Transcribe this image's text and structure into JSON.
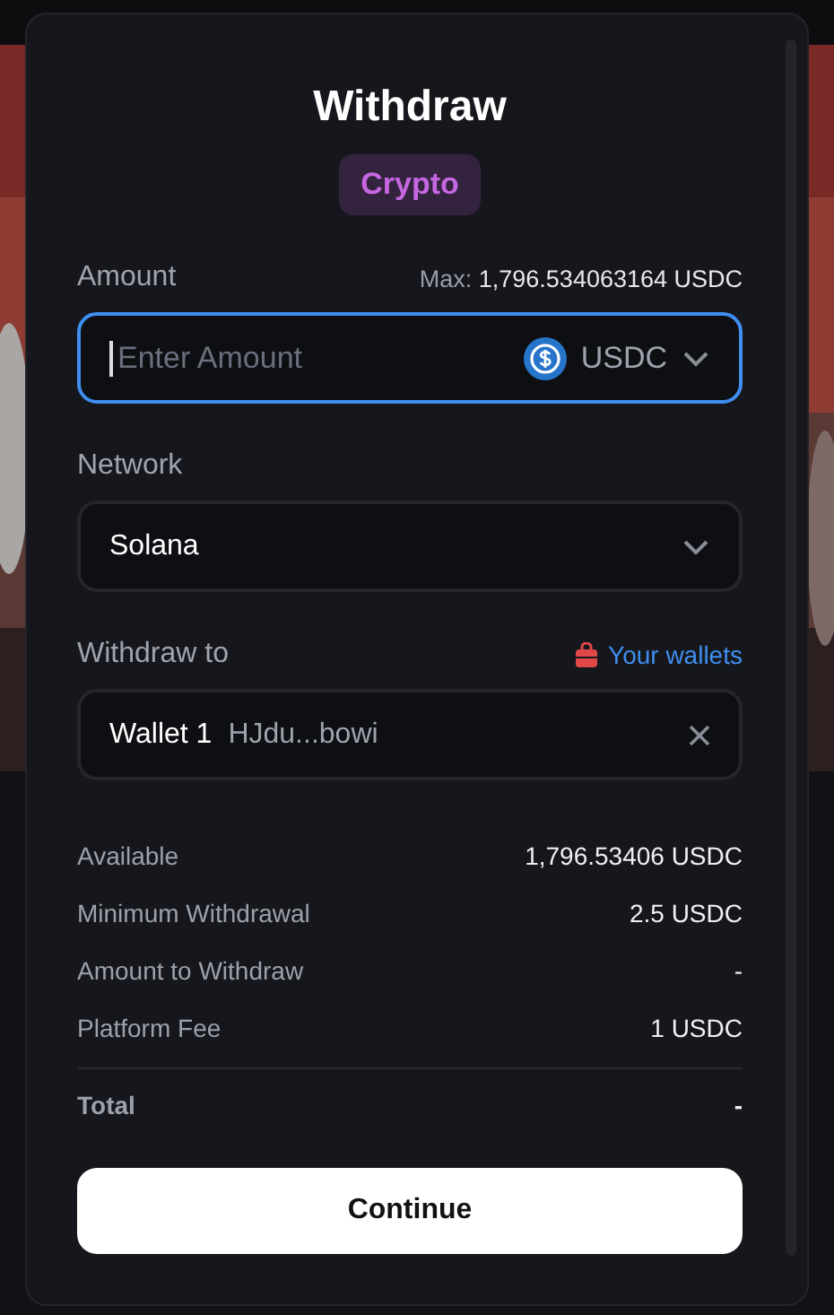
{
  "dialog": {
    "title": "Withdraw",
    "badge": "Crypto"
  },
  "amount": {
    "label": "Amount",
    "max_label": "Max:",
    "max_value": "1,796.534063164 USDC",
    "placeholder": "Enter Amount",
    "currency": "USDC",
    "focused": true
  },
  "network": {
    "label": "Network",
    "value": "Solana"
  },
  "withdraw_to": {
    "label": "Withdraw to",
    "link": "Your wallets",
    "wallet_name": "Wallet 1",
    "wallet_address": "HJdu...bowi"
  },
  "summary": [
    {
      "label": "Available",
      "value": "1,796.53406 USDC",
      "emphasized": false
    },
    {
      "label": "Minimum Withdrawal",
      "value": "2.5 USDC",
      "emphasized": false
    },
    {
      "label": "Amount to Withdraw",
      "value": "-",
      "emphasized": false
    },
    {
      "label": "Platform Fee",
      "value": "1 USDC",
      "emphasized": false
    },
    {
      "label": "Total",
      "value": "-",
      "emphasized": true
    }
  ],
  "button": "Continue"
}
